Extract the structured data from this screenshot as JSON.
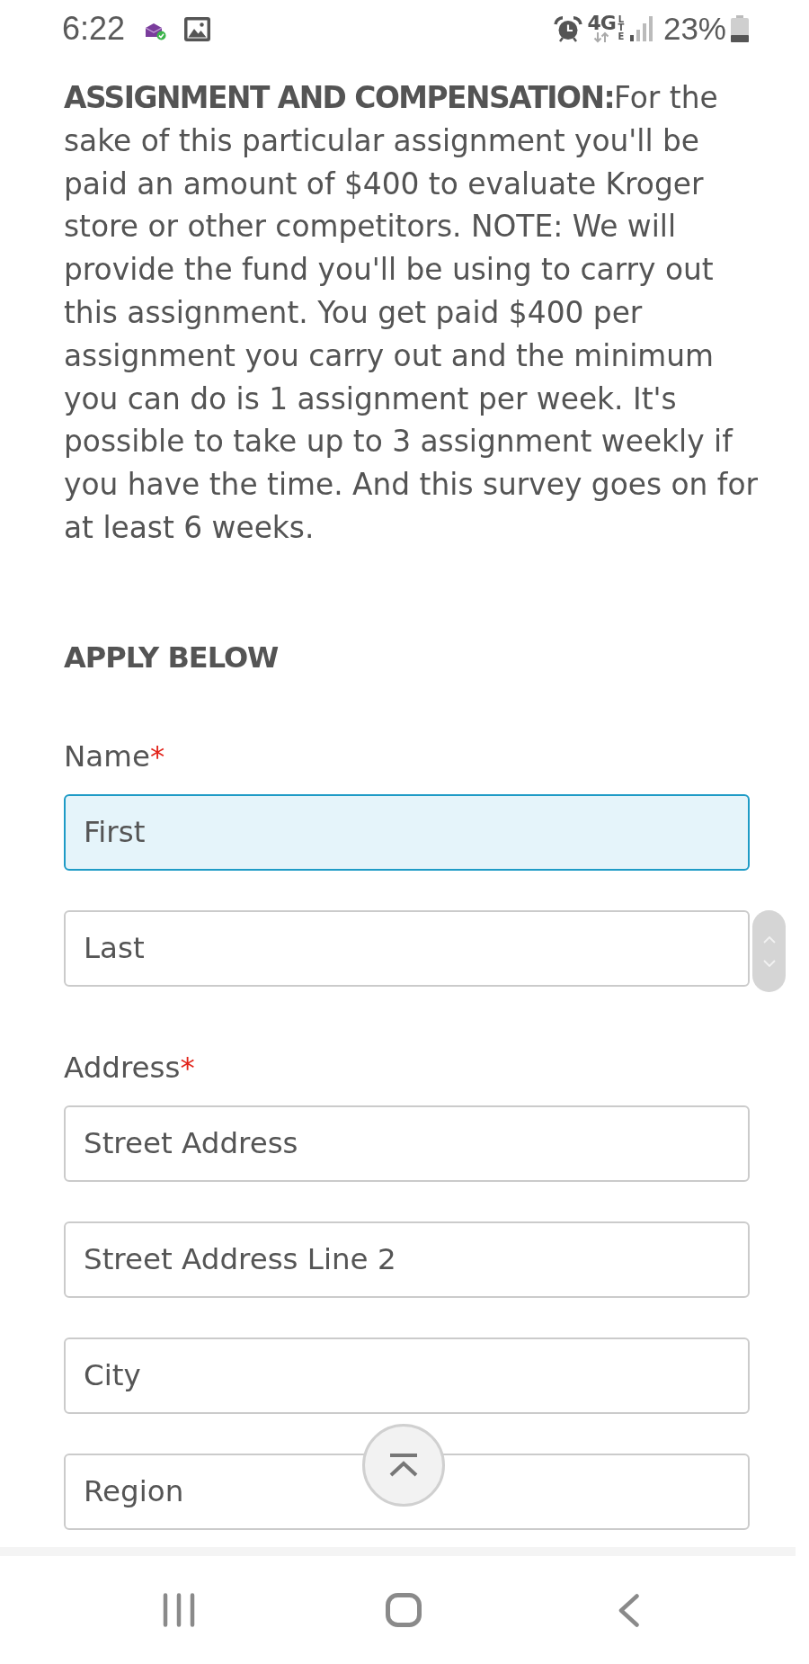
{
  "status_bar": {
    "time": "6:22",
    "network_type": "4G",
    "network_tech": "LTE",
    "battery": "23%"
  },
  "article": {
    "text": "**ASSIGNMENT AND COMPENSATION:**For the sake of this particular assignment you'll be paid an amount of $400 to evaluate Kroger store or other competitors. NOTE: We will provide the fund you'll be using to carry out this assignment. You get paid $400 per assignment you carry out and the minimum you can do is 1 assignment per week. It's possible to take up to 3 assignment weekly if you have the time. And this survey goes on for at least 6 weeks."
  },
  "section_title": "APPLY BELOW",
  "form": {
    "groups": [
      {
        "label": "Name",
        "required_mark": "*",
        "inputs": [
          {
            "placeholder": "First",
            "focused": true
          },
          {
            "placeholder": "Last",
            "focused": false
          }
        ]
      },
      {
        "label": "Address",
        "required_mark": "*",
        "inputs": [
          {
            "placeholder": "Street Address",
            "focused": false
          },
          {
            "placeholder": "Street Address Line 2",
            "focused": false
          },
          {
            "placeholder": "City",
            "focused": false
          },
          {
            "placeholder": "Region",
            "focused": false
          }
        ]
      }
    ]
  }
}
